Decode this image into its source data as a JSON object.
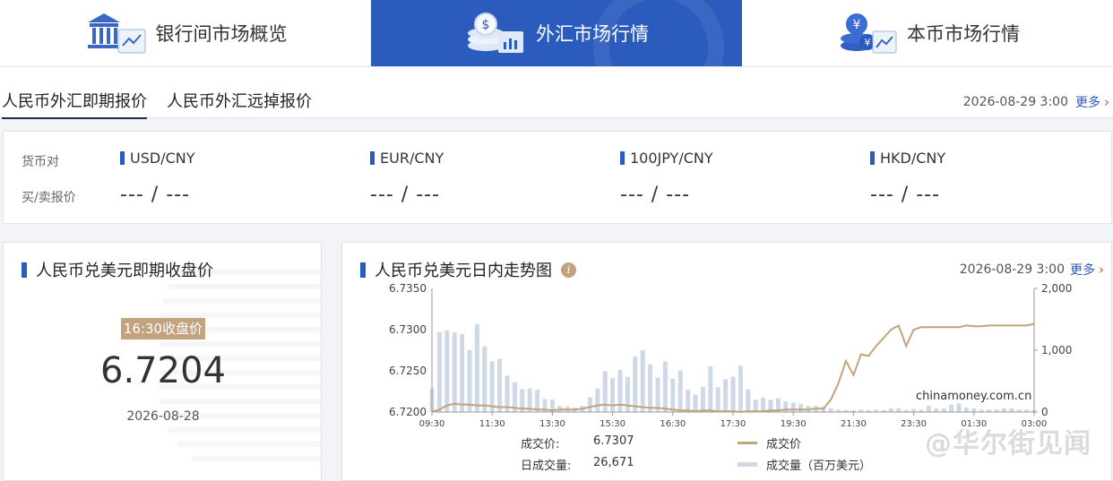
{
  "nav": {
    "tabs": [
      {
        "label": "银行间市场概览",
        "icon": "bank-building-icon"
      },
      {
        "label": "外汇市场行情",
        "icon": "coin-stack-icon"
      },
      {
        "label": "本币市场行情",
        "icon": "yuan-coin-icon"
      }
    ],
    "active": 1
  },
  "subtabs": {
    "items": [
      "人民币外汇即期报价",
      "人民币外汇远掉报价"
    ],
    "timestamp": "2026-08-29 3:00",
    "more": "更多"
  },
  "quotes": {
    "row_label_pair": "货币对",
    "row_label_price": "买/卖报价",
    "pairs": [
      {
        "name": "USD/CNY",
        "value": "--- / ---"
      },
      {
        "name": "EUR/CNY",
        "value": "--- / ---"
      },
      {
        "name": "100JPY/CNY",
        "value": "--- / ---"
      },
      {
        "name": "HKD/CNY",
        "value": "--- / ---"
      }
    ]
  },
  "close_panel": {
    "title": "人民币兑美元即期收盘价",
    "badge": "16:30收盘价",
    "value": "6.7204",
    "date": "2026-08-28"
  },
  "chart_panel": {
    "title": "人民币兑美元日内走势图",
    "info": "i",
    "timestamp": "2026-08-29 3:00",
    "more": "更多",
    "source": "chinamoney.com.cn",
    "price_label": "成交价:",
    "price_value": "6.7307",
    "volume_label": "日成交量:",
    "volume_value": "26,671",
    "legend_price": "成交价",
    "legend_volume": "成交量（百万美元）"
  },
  "watermark": "@华尔街见闻",
  "chart_data": {
    "type": "line",
    "x_ticks": [
      "09:30",
      "11:30",
      "13:30",
      "15:30",
      "16:30",
      "17:30",
      "19:30",
      "21:30",
      "23:30",
      "01:30",
      "03:00"
    ],
    "y_left_ticks": [
      "6.7350",
      "6.7300",
      "6.7250",
      "6.7200"
    ],
    "y_left_range": [
      6.72,
      6.735
    ],
    "y_right_ticks": [
      "2,000",
      "1,000",
      "0"
    ],
    "y_right_range": [
      0,
      2000
    ],
    "series": [
      {
        "name": "成交价",
        "color": "#c3a27e",
        "values": [
          6.72,
          6.7203,
          6.7208,
          6.721,
          6.7209,
          6.7209,
          6.7208,
          6.7208,
          6.7207,
          6.7206,
          6.7206,
          6.7205,
          6.7204,
          6.7204,
          6.7203,
          6.7203,
          6.7202,
          6.7203,
          6.7203,
          6.7203,
          6.7204,
          6.7206,
          6.7208,
          6.7209,
          6.7208,
          6.7209,
          6.7208,
          6.7207,
          6.7206,
          6.7205,
          6.7205,
          6.7204,
          6.7203,
          6.7202,
          6.7202,
          6.7201,
          6.7202,
          6.7202,
          6.7201,
          6.7201,
          6.7201,
          6.72,
          6.7201,
          6.7201,
          6.7201,
          6.7202,
          6.7202,
          6.7203,
          6.7203,
          6.7203,
          6.7203,
          6.7204,
          6.7204,
          6.7215,
          6.7235,
          6.7262,
          6.7245,
          6.727,
          6.7268,
          6.728,
          6.729,
          6.73,
          6.7305,
          6.728,
          6.73,
          6.7303,
          6.7303,
          6.7303,
          6.7303,
          6.7303,
          6.7303,
          6.7305,
          6.7304,
          6.7304,
          6.7305,
          6.7305,
          6.7305,
          6.7305,
          6.7305,
          6.7305,
          6.7307
        ]
      },
      {
        "name": "成交量（百万美元）",
        "color": "#cfd8e6",
        "type": "bar",
        "values": [
          380,
          1290,
          1320,
          1290,
          1260,
          1000,
          1420,
          1060,
          820,
          860,
          590,
          480,
          370,
          380,
          360,
          210,
          200,
          100,
          90,
          70,
          100,
          240,
          380,
          660,
          550,
          680,
          570,
          900,
          1000,
          770,
          560,
          820,
          540,
          670,
          360,
          280,
          410,
          740,
          400,
          530,
          570,
          750,
          370,
          200,
          230,
          200,
          220,
          170,
          150,
          130,
          100,
          100,
          80,
          60,
          40,
          30,
          30,
          40,
          30,
          40,
          30,
          60,
          60,
          30,
          50,
          40,
          100,
          60,
          60,
          120,
          140,
          70,
          60,
          40,
          40,
          40,
          60,
          60,
          40,
          40,
          30
        ]
      }
    ]
  }
}
